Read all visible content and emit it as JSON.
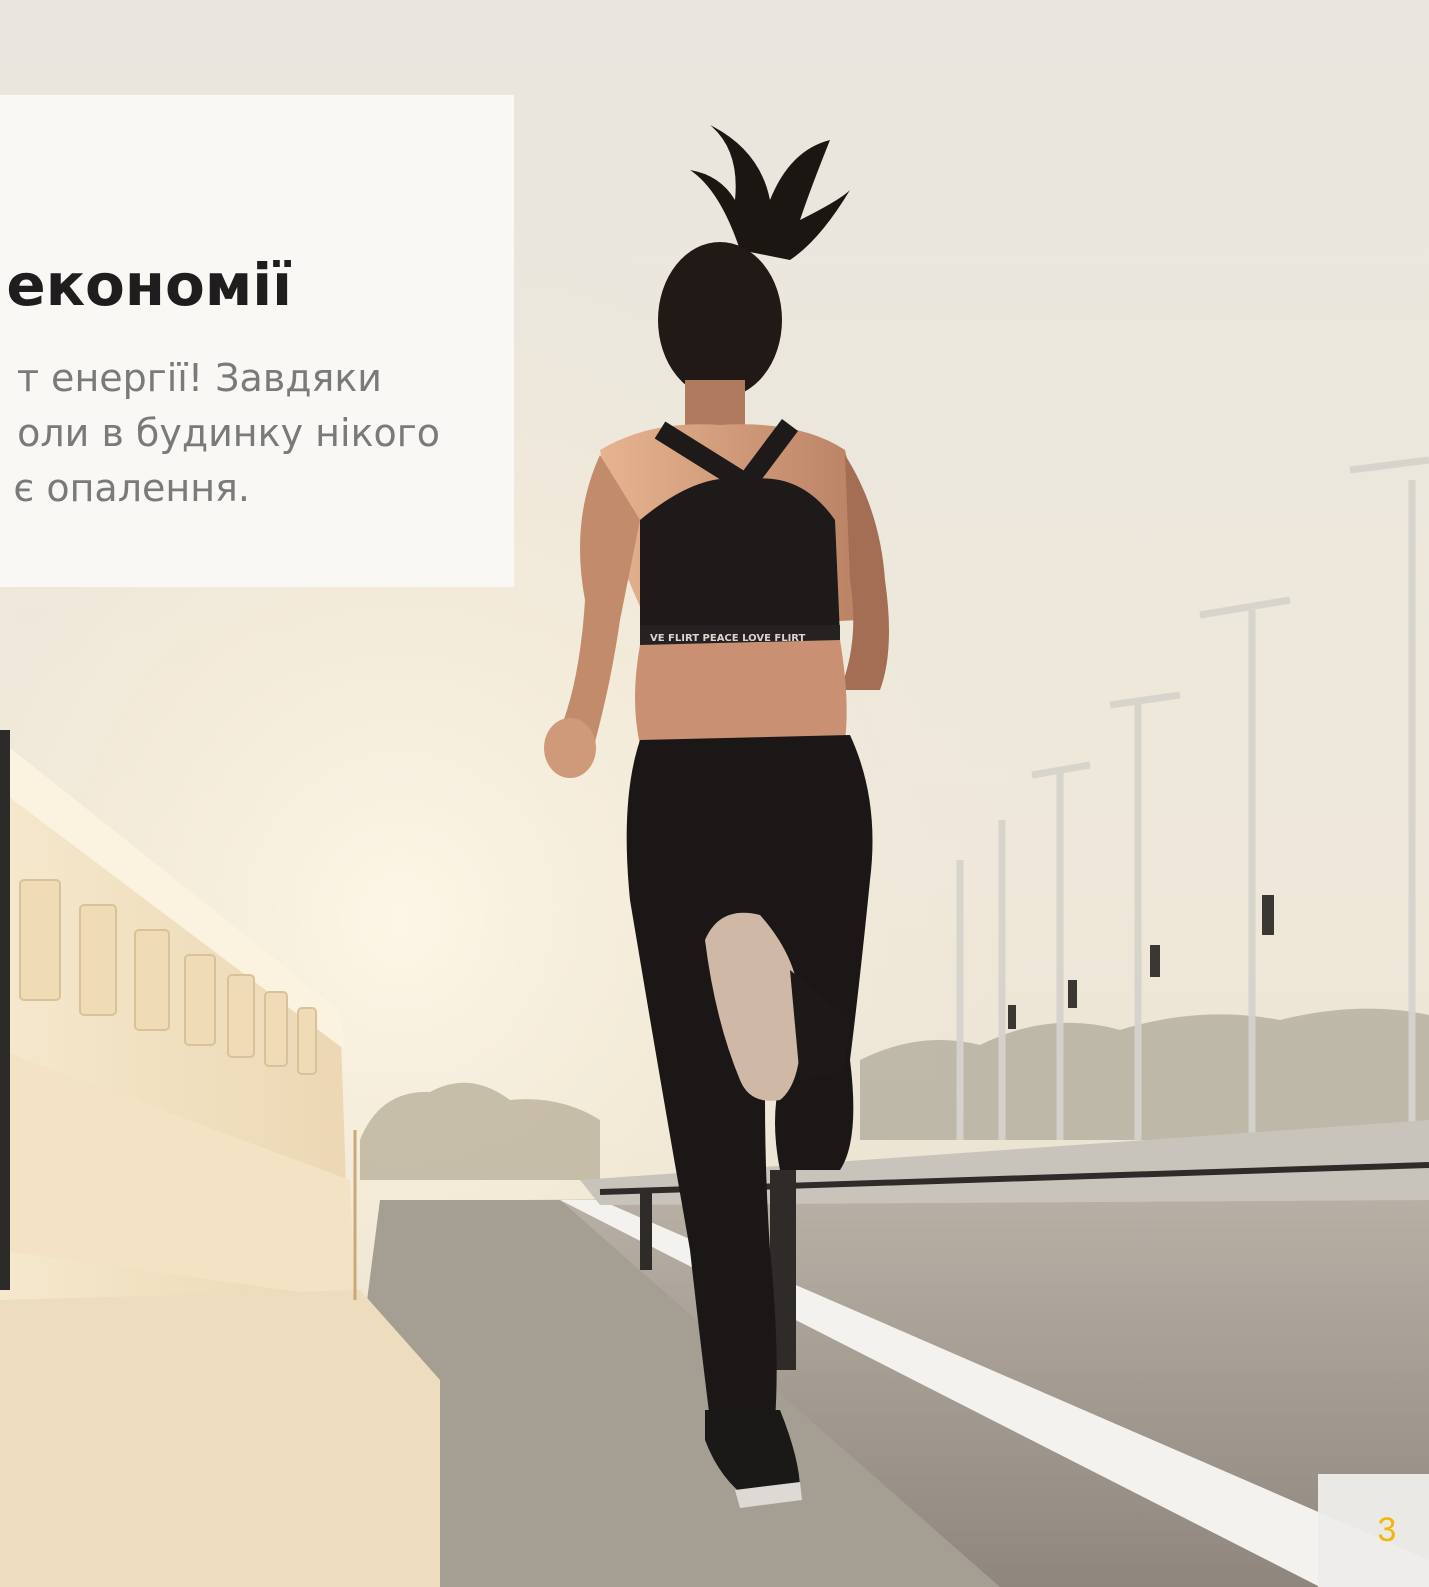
{
  "card": {
    "title": "економії",
    "lines": [
      "т енергії! Завдяки",
      "оли в будинку нікого",
      "є опалення."
    ]
  },
  "photo": {
    "top_band_text": "PEACE LOVE",
    "bottom_band_text": "VE FLIRT PEACE LOVE FLIRT"
  },
  "page": {
    "number": "3"
  },
  "colors": {
    "accent": "#f2b705",
    "title": "#1f1d1e",
    "body": "#7a7a7a"
  }
}
